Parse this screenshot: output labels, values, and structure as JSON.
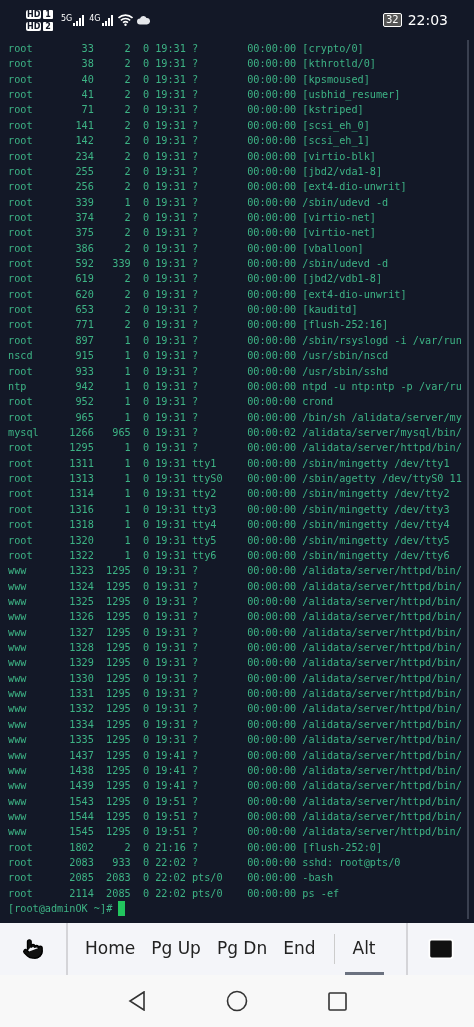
{
  "status_bar": {
    "sims": [
      {
        "label": "HD",
        "slot": "1"
      },
      {
        "label": "HD",
        "slot": "2"
      }
    ],
    "networks": [
      "5G",
      "4G"
    ],
    "battery": "32",
    "time": "22:03"
  },
  "terminal": {
    "rows": [
      [
        "root",
        "33",
        "2",
        "0",
        "19:31",
        "?",
        "00:00:00",
        "[crypto/0]"
      ],
      [
        "root",
        "38",
        "2",
        "0",
        "19:31",
        "?",
        "00:00:00",
        "[kthrotld/0]"
      ],
      [
        "root",
        "40",
        "2",
        "0",
        "19:31",
        "?",
        "00:00:00",
        "[kpsmoused]"
      ],
      [
        "root",
        "41",
        "2",
        "0",
        "19:31",
        "?",
        "00:00:00",
        "[usbhid_resumer]"
      ],
      [
        "root",
        "71",
        "2",
        "0",
        "19:31",
        "?",
        "00:00:00",
        "[kstriped]"
      ],
      [
        "root",
        "141",
        "2",
        "0",
        "19:31",
        "?",
        "00:00:00",
        "[scsi_eh_0]"
      ],
      [
        "root",
        "142",
        "2",
        "0",
        "19:31",
        "?",
        "00:00:00",
        "[scsi_eh_1]"
      ],
      [
        "root",
        "234",
        "2",
        "0",
        "19:31",
        "?",
        "00:00:00",
        "[virtio-blk]"
      ],
      [
        "root",
        "255",
        "2",
        "0",
        "19:31",
        "?",
        "00:00:00",
        "[jbd2/vda1-8]"
      ],
      [
        "root",
        "256",
        "2",
        "0",
        "19:31",
        "?",
        "00:00:00",
        "[ext4-dio-unwrit]"
      ],
      [
        "root",
        "339",
        "1",
        "0",
        "19:31",
        "?",
        "00:00:00",
        "/sbin/udevd -d"
      ],
      [
        "root",
        "374",
        "2",
        "0",
        "19:31",
        "?",
        "00:00:00",
        "[virtio-net]"
      ],
      [
        "root",
        "375",
        "2",
        "0",
        "19:31",
        "?",
        "00:00:00",
        "[virtio-net]"
      ],
      [
        "root",
        "386",
        "2",
        "0",
        "19:31",
        "?",
        "00:00:00",
        "[vballoon]"
      ],
      [
        "root",
        "592",
        "339",
        "0",
        "19:31",
        "?",
        "00:00:00",
        "/sbin/udevd -d"
      ],
      [
        "root",
        "619",
        "2",
        "0",
        "19:31",
        "?",
        "00:00:00",
        "[jbd2/vdb1-8]"
      ],
      [
        "root",
        "620",
        "2",
        "0",
        "19:31",
        "?",
        "00:00:00",
        "[ext4-dio-unwrit]"
      ],
      [
        "root",
        "653",
        "2",
        "0",
        "19:31",
        "?",
        "00:00:00",
        "[kauditd]"
      ],
      [
        "root",
        "771",
        "2",
        "0",
        "19:31",
        "?",
        "00:00:00",
        "[flush-252:16]"
      ],
      [
        "root",
        "897",
        "1",
        "0",
        "19:31",
        "?",
        "00:00:00",
        "/sbin/rsyslogd -i /var/run"
      ],
      [
        "nscd",
        "915",
        "1",
        "0",
        "19:31",
        "?",
        "00:00:00",
        "/usr/sbin/nscd"
      ],
      [
        "root",
        "933",
        "1",
        "0",
        "19:31",
        "?",
        "00:00:00",
        "/usr/sbin/sshd"
      ],
      [
        "ntp",
        "942",
        "1",
        "0",
        "19:31",
        "?",
        "00:00:00",
        "ntpd -u ntp:ntp -p /var/ru"
      ],
      [
        "root",
        "952",
        "1",
        "0",
        "19:31",
        "?",
        "00:00:00",
        "crond"
      ],
      [
        "root",
        "965",
        "1",
        "0",
        "19:31",
        "?",
        "00:00:00",
        "/bin/sh /alidata/server/my"
      ],
      [
        "mysql",
        "1266",
        "965",
        "0",
        "19:31",
        "?",
        "00:00:02",
        "/alidata/server/mysql/bin/"
      ],
      [
        "root",
        "1295",
        "1",
        "0",
        "19:31",
        "?",
        "00:00:00",
        "/alidata/server/httpd/bin/"
      ],
      [
        "root",
        "1311",
        "1",
        "0",
        "19:31",
        "tty1",
        "00:00:00",
        "/sbin/mingetty /dev/tty1"
      ],
      [
        "root",
        "1313",
        "1",
        "0",
        "19:31",
        "ttyS0",
        "00:00:00",
        "/sbin/agetty /dev/ttyS0 11"
      ],
      [
        "root",
        "1314",
        "1",
        "0",
        "19:31",
        "tty2",
        "00:00:00",
        "/sbin/mingetty /dev/tty2"
      ],
      [
        "root",
        "1316",
        "1",
        "0",
        "19:31",
        "tty3",
        "00:00:00",
        "/sbin/mingetty /dev/tty3"
      ],
      [
        "root",
        "1318",
        "1",
        "0",
        "19:31",
        "tty4",
        "00:00:00",
        "/sbin/mingetty /dev/tty4"
      ],
      [
        "root",
        "1320",
        "1",
        "0",
        "19:31",
        "tty5",
        "00:00:00",
        "/sbin/mingetty /dev/tty5"
      ],
      [
        "root",
        "1322",
        "1",
        "0",
        "19:31",
        "tty6",
        "00:00:00",
        "/sbin/mingetty /dev/tty6"
      ],
      [
        "www",
        "1323",
        "1295",
        "0",
        "19:31",
        "?",
        "00:00:00",
        "/alidata/server/httpd/bin/"
      ],
      [
        "www",
        "1324",
        "1295",
        "0",
        "19:31",
        "?",
        "00:00:00",
        "/alidata/server/httpd/bin/"
      ],
      [
        "www",
        "1325",
        "1295",
        "0",
        "19:31",
        "?",
        "00:00:00",
        "/alidata/server/httpd/bin/"
      ],
      [
        "www",
        "1326",
        "1295",
        "0",
        "19:31",
        "?",
        "00:00:00",
        "/alidata/server/httpd/bin/"
      ],
      [
        "www",
        "1327",
        "1295",
        "0",
        "19:31",
        "?",
        "00:00:00",
        "/alidata/server/httpd/bin/"
      ],
      [
        "www",
        "1328",
        "1295",
        "0",
        "19:31",
        "?",
        "00:00:00",
        "/alidata/server/httpd/bin/"
      ],
      [
        "www",
        "1329",
        "1295",
        "0",
        "19:31",
        "?",
        "00:00:00",
        "/alidata/server/httpd/bin/"
      ],
      [
        "www",
        "1330",
        "1295",
        "0",
        "19:31",
        "?",
        "00:00:00",
        "/alidata/server/httpd/bin/"
      ],
      [
        "www",
        "1331",
        "1295",
        "0",
        "19:31",
        "?",
        "00:00:00",
        "/alidata/server/httpd/bin/"
      ],
      [
        "www",
        "1332",
        "1295",
        "0",
        "19:31",
        "?",
        "00:00:00",
        "/alidata/server/httpd/bin/"
      ],
      [
        "www",
        "1334",
        "1295",
        "0",
        "19:31",
        "?",
        "00:00:00",
        "/alidata/server/httpd/bin/"
      ],
      [
        "www",
        "1335",
        "1295",
        "0",
        "19:31",
        "?",
        "00:00:00",
        "/alidata/server/httpd/bin/"
      ],
      [
        "www",
        "1437",
        "1295",
        "0",
        "19:41",
        "?",
        "00:00:00",
        "/alidata/server/httpd/bin/"
      ],
      [
        "www",
        "1438",
        "1295",
        "0",
        "19:41",
        "?",
        "00:00:00",
        "/alidata/server/httpd/bin/"
      ],
      [
        "www",
        "1439",
        "1295",
        "0",
        "19:41",
        "?",
        "00:00:00",
        "/alidata/server/httpd/bin/"
      ],
      [
        "www",
        "1543",
        "1295",
        "0",
        "19:51",
        "?",
        "00:00:00",
        "/alidata/server/httpd/bin/"
      ],
      [
        "www",
        "1544",
        "1295",
        "0",
        "19:51",
        "?",
        "00:00:00",
        "/alidata/server/httpd/bin/"
      ],
      [
        "www",
        "1545",
        "1295",
        "0",
        "19:51",
        "?",
        "00:00:00",
        "/alidata/server/httpd/bin/"
      ],
      [
        "root",
        "1802",
        "2",
        "0",
        "21:16",
        "?",
        "00:00:00",
        "[flush-252:0]"
      ],
      [
        "root",
        "2083",
        "933",
        "0",
        "22:02",
        "?",
        "00:00:00",
        "sshd: root@pts/0"
      ],
      [
        "root",
        "2085",
        "2083",
        "0",
        "22:02",
        "pts/0",
        "00:00:00",
        "-bash"
      ],
      [
        "root",
        "2114",
        "2085",
        "0",
        "22:02",
        "pts/0",
        "00:00:00",
        "ps -ef"
      ]
    ],
    "prompt": "[root@adminOK ~]#"
  },
  "extra_keys": {
    "keys": [
      {
        "label": "Home",
        "selected": false
      },
      {
        "label": "Pg Up",
        "selected": false
      },
      {
        "label": "Pg Dn",
        "selected": false
      },
      {
        "label": "End",
        "selected": false
      },
      {
        "label": "Alt",
        "selected": true
      }
    ]
  }
}
